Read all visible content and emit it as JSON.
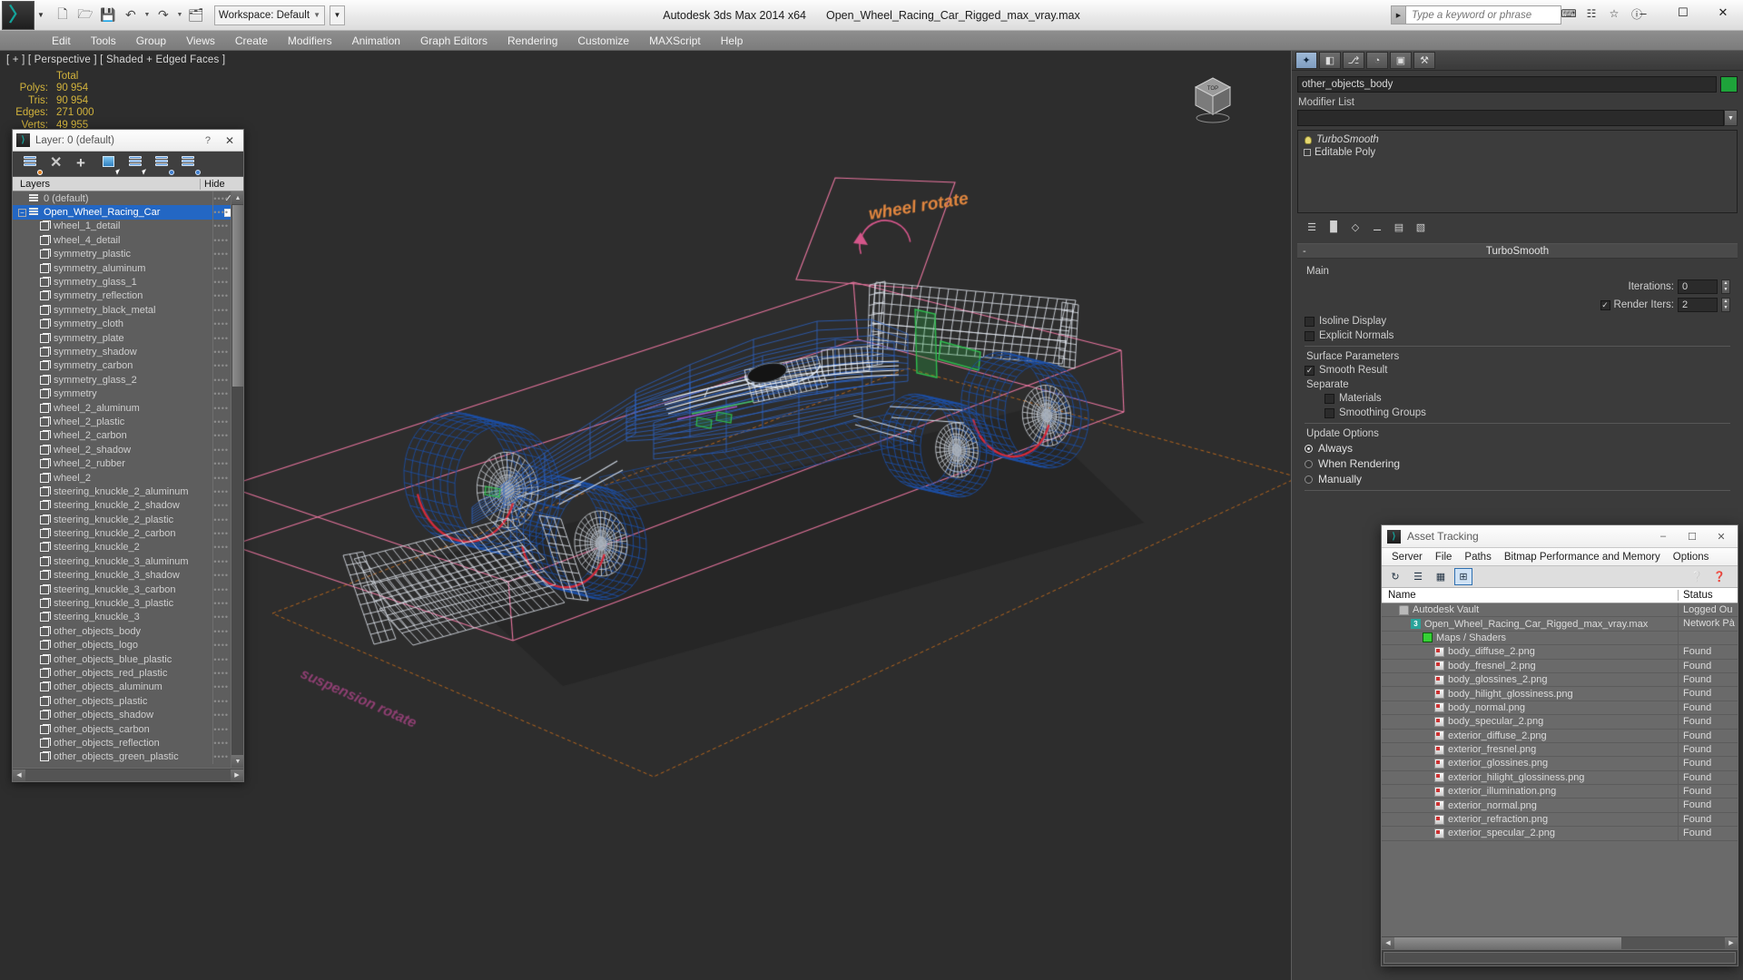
{
  "titlebar": {
    "logo_glyph": "〉",
    "app_title": "Autodesk 3ds Max  2014 x64",
    "file_title": "Open_Wheel_Racing_Car_Rigged_max_vray.max",
    "workspace_label": "Workspace: Default",
    "quick_access": [
      {
        "name": "new-file-icon",
        "glyph": "⬚"
      },
      {
        "name": "open-file-icon",
        "glyph": "🗁"
      },
      {
        "name": "save-file-icon",
        "glyph": "💾"
      },
      {
        "name": "undo-icon",
        "glyph": "↶"
      },
      {
        "name": "redo-icon",
        "glyph": "↷"
      },
      {
        "name": "project-folder-icon",
        "glyph": "🗂"
      }
    ],
    "search_placeholder": "Type a keyword or phrase",
    "window_buttons": [
      "–",
      "❐",
      "✕"
    ],
    "extra_icons": [
      "⌨",
      "☷",
      "☆"
    ],
    "help_icon": "?"
  },
  "menu": {
    "items": [
      "Edit",
      "Tools",
      "Group",
      "Views",
      "Create",
      "Modifiers",
      "Animation",
      "Graph Editors",
      "Rendering",
      "Customize",
      "MAXScript",
      "Help"
    ]
  },
  "viewport": {
    "label": "[ + ] [ Perspective ] [ Shaded + Edged Faces ]",
    "stats": {
      "column_header": "Total",
      "rows": [
        {
          "key": "Polys:",
          "value": "90 954"
        },
        {
          "key": "Tris:",
          "value": "90 954"
        },
        {
          "key": "Edges:",
          "value": "271 000"
        },
        {
          "key": "Verts:",
          "value": "49 955"
        }
      ]
    },
    "annotation_text": "wheel rotate",
    "viewcube_label": "TOP"
  },
  "layer_dialog": {
    "title": "Layer: 0 (default)",
    "help_icon": "?",
    "close_icon": "✕",
    "toolbar": [
      {
        "name": "new-layer-icon"
      },
      {
        "name": "delete-layer-icon"
      },
      {
        "name": "add-layer-icon"
      },
      {
        "name": "select-objects-icon"
      },
      {
        "name": "select-highlighted-layer-icon"
      },
      {
        "name": "highlight-selected-objects-icon"
      },
      {
        "name": "layer-properties-icon"
      }
    ],
    "columns": {
      "name": "Layers",
      "hide": "Hide"
    },
    "rows": [
      {
        "label": "0 (default)",
        "indent": 0,
        "icon": "stack",
        "selected": false,
        "hide": "check"
      },
      {
        "label": "Open_Wheel_Racing_Car",
        "indent": 0,
        "icon": "stack",
        "selected": true,
        "expander": "−",
        "hide": "square"
      },
      {
        "label": "wheel_1_detail",
        "indent": 1,
        "icon": "cube"
      },
      {
        "label": "wheel_4_detail",
        "indent": 1,
        "icon": "cube"
      },
      {
        "label": "symmetry_plastic",
        "indent": 1,
        "icon": "cube"
      },
      {
        "label": "symmetry_aluminum",
        "indent": 1,
        "icon": "cube"
      },
      {
        "label": "symmetry_glass_1",
        "indent": 1,
        "icon": "cube"
      },
      {
        "label": "symmetry_reflection",
        "indent": 1,
        "icon": "cube"
      },
      {
        "label": "symmetry_black_metal",
        "indent": 1,
        "icon": "cube"
      },
      {
        "label": "symmetry_cloth",
        "indent": 1,
        "icon": "cube"
      },
      {
        "label": "symmetry_plate",
        "indent": 1,
        "icon": "cube"
      },
      {
        "label": "symmetry_shadow",
        "indent": 1,
        "icon": "cube"
      },
      {
        "label": "symmetry_carbon",
        "indent": 1,
        "icon": "cube"
      },
      {
        "label": "symmetry_glass_2",
        "indent": 1,
        "icon": "cube"
      },
      {
        "label": "symmetry",
        "indent": 1,
        "icon": "cube"
      },
      {
        "label": "wheel_2_aluminum",
        "indent": 1,
        "icon": "cube"
      },
      {
        "label": "wheel_2_plastic",
        "indent": 1,
        "icon": "cube"
      },
      {
        "label": "wheel_2_carbon",
        "indent": 1,
        "icon": "cube"
      },
      {
        "label": "wheel_2_shadow",
        "indent": 1,
        "icon": "cube"
      },
      {
        "label": "wheel_2_rubber",
        "indent": 1,
        "icon": "cube"
      },
      {
        "label": "wheel_2",
        "indent": 1,
        "icon": "cube"
      },
      {
        "label": "steering_knuckle_2_aluminum",
        "indent": 1,
        "icon": "cube"
      },
      {
        "label": "steering_knuckle_2_shadow",
        "indent": 1,
        "icon": "cube"
      },
      {
        "label": "steering_knuckle_2_plastic",
        "indent": 1,
        "icon": "cube"
      },
      {
        "label": "steering_knuckle_2_carbon",
        "indent": 1,
        "icon": "cube"
      },
      {
        "label": "steering_knuckle_2",
        "indent": 1,
        "icon": "cube"
      },
      {
        "label": "steering_knuckle_3_aluminum",
        "indent": 1,
        "icon": "cube"
      },
      {
        "label": "steering_knuckle_3_shadow",
        "indent": 1,
        "icon": "cube"
      },
      {
        "label": "steering_knuckle_3_carbon",
        "indent": 1,
        "icon": "cube"
      },
      {
        "label": "steering_knuckle_3_plastic",
        "indent": 1,
        "icon": "cube"
      },
      {
        "label": "steering_knuckle_3",
        "indent": 1,
        "icon": "cube"
      },
      {
        "label": "other_objects_body",
        "indent": 1,
        "icon": "cube"
      },
      {
        "label": "other_objects_logo",
        "indent": 1,
        "icon": "cube"
      },
      {
        "label": "other_objects_blue_plastic",
        "indent": 1,
        "icon": "cube"
      },
      {
        "label": "other_objects_red_plastic",
        "indent": 1,
        "icon": "cube"
      },
      {
        "label": "other_objects_aluminum",
        "indent": 1,
        "icon": "cube"
      },
      {
        "label": "other_objects_plastic",
        "indent": 1,
        "icon": "cube"
      },
      {
        "label": "other_objects_shadow",
        "indent": 1,
        "icon": "cube"
      },
      {
        "label": "other_objects_carbon",
        "indent": 1,
        "icon": "cube"
      },
      {
        "label": "other_objects_reflection",
        "indent": 1,
        "icon": "cube"
      },
      {
        "label": "other_objects_green_plastic",
        "indent": 1,
        "icon": "cube"
      }
    ]
  },
  "command_panel": {
    "tabs": [
      {
        "name": "create-tab",
        "glyph": "✦",
        "active": true
      },
      {
        "name": "modify-tab",
        "glyph": "◧"
      },
      {
        "name": "hierarchy-tab",
        "glyph": "⎇"
      },
      {
        "name": "motion-tab",
        "glyph": "◔"
      },
      {
        "name": "display-tab",
        "glyph": "▣"
      },
      {
        "name": "utilities-tab",
        "glyph": "⚒"
      }
    ],
    "object_name": "other_objects_body",
    "object_color": "#1ea33a",
    "modifier_list_label": "Modifier List",
    "modifier_stack": [
      {
        "label": "TurboSmooth",
        "type": "modifier"
      },
      {
        "label": "Editable Poly",
        "type": "base"
      }
    ],
    "stack_tools": [
      "❐",
      "↑",
      "★",
      "⊘",
      "⛃",
      "⌫"
    ],
    "rollup": {
      "title": "TurboSmooth",
      "marker": "-",
      "sections": [
        {
          "label": "Main",
          "fields": [
            {
              "type": "spin",
              "label": "Iterations:",
              "value": "0"
            },
            {
              "type": "checkspin",
              "label": "Render Iters:",
              "value": "2",
              "checked": true
            },
            {
              "type": "check",
              "label": "Isoline Display",
              "checked": false
            },
            {
              "type": "check",
              "label": "Explicit Normals",
              "checked": false
            }
          ]
        },
        {
          "label": "Surface Parameters",
          "fields": [
            {
              "type": "check",
              "label": "Smooth Result",
              "checked": true
            },
            {
              "type": "label",
              "label": "Separate"
            },
            {
              "type": "check",
              "label": "Materials",
              "checked": false,
              "indent": true
            },
            {
              "type": "check",
              "label": "Smoothing Groups",
              "checked": false,
              "indent": true
            }
          ]
        },
        {
          "label": "Update Options",
          "fields": [
            {
              "type": "radio",
              "label": "Always",
              "on": true
            },
            {
              "type": "radio",
              "label": "When Rendering",
              "on": false
            },
            {
              "type": "radio",
              "label": "Manually",
              "on": false
            }
          ]
        }
      ]
    }
  },
  "asset_tracking": {
    "title": "Asset Tracking",
    "window_buttons": [
      "–",
      "❐",
      "✕"
    ],
    "menu": [
      "Server",
      "File",
      "Paths",
      "Bitmap Performance and Memory",
      "Options"
    ],
    "toolbar": [
      {
        "name": "refresh-icon",
        "glyph": "↻",
        "selected": false
      },
      {
        "name": "list-view-icon",
        "glyph": "☰",
        "selected": false
      },
      {
        "name": "detail-view-icon",
        "glyph": "▦",
        "selected": false
      },
      {
        "name": "grid-view-icon",
        "glyph": "⊞",
        "selected": true
      },
      {
        "name": "add-help-icon",
        "glyph": "❓",
        "selected": false
      },
      {
        "name": "help-icon",
        "glyph": "❔",
        "selected": false
      }
    ],
    "columns": {
      "name": "Name",
      "status": "Status"
    },
    "rows": [
      {
        "name": "Autodesk Vault",
        "status": "Logged Ou",
        "indent": 1,
        "icon": "vault"
      },
      {
        "name": "Open_Wheel_Racing_Car_Rigged_max_vray.max",
        "status": "Network Pà",
        "indent": 2,
        "icon": "maxfile"
      },
      {
        "name": "Maps / Shaders",
        "status": "",
        "indent": 3,
        "icon": "maps"
      },
      {
        "name": "body_diffuse_2.png",
        "status": "Found",
        "indent": 4,
        "icon": "png"
      },
      {
        "name": "body_fresnel_2.png",
        "status": "Found",
        "indent": 4,
        "icon": "png"
      },
      {
        "name": "body_glossines_2.png",
        "status": "Found",
        "indent": 4,
        "icon": "png"
      },
      {
        "name": "body_hilight_glossiness.png",
        "status": "Found",
        "indent": 4,
        "icon": "png"
      },
      {
        "name": "body_normal.png",
        "status": "Found",
        "indent": 4,
        "icon": "png"
      },
      {
        "name": "body_specular_2.png",
        "status": "Found",
        "indent": 4,
        "icon": "png"
      },
      {
        "name": "exterior_diffuse_2.png",
        "status": "Found",
        "indent": 4,
        "icon": "png"
      },
      {
        "name": "exterior_fresnel.png",
        "status": "Found",
        "indent": 4,
        "icon": "png"
      },
      {
        "name": "exterior_glossines.png",
        "status": "Found",
        "indent": 4,
        "icon": "png"
      },
      {
        "name": "exterior_hilight_glossiness.png",
        "status": "Found",
        "indent": 4,
        "icon": "png"
      },
      {
        "name": "exterior_illumination.png",
        "status": "Found",
        "indent": 4,
        "icon": "png"
      },
      {
        "name": "exterior_normal.png",
        "status": "Found",
        "indent": 4,
        "icon": "png"
      },
      {
        "name": "exterior_refraction.png",
        "status": "Found",
        "indent": 4,
        "icon": "png"
      },
      {
        "name": "exterior_specular_2.png",
        "status": "Found",
        "indent": 4,
        "icon": "png"
      }
    ]
  }
}
